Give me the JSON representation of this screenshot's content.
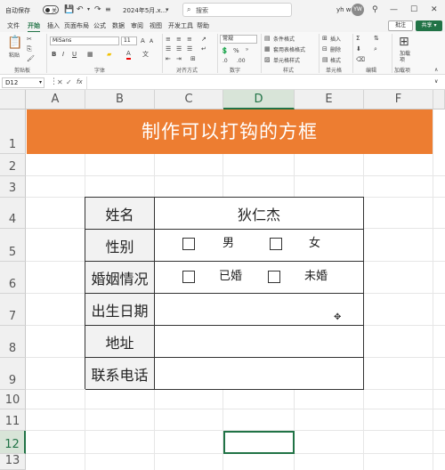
{
  "titlebar": {
    "autosave_label": "自动保存",
    "autosave_state": "关",
    "file_name": "2024年5月.x...",
    "search_placeholder": "搜索",
    "user_name": "yh w",
    "user_initials": "YW"
  },
  "menu": {
    "items": [
      "文件",
      "开始",
      "插入",
      "页面布局",
      "公式",
      "数据",
      "审阅",
      "视图",
      "开发工具",
      "帮助"
    ],
    "active": "开始",
    "comment_label": "批注",
    "share_label": "共享"
  },
  "ribbon": {
    "paste_label": "粘贴",
    "font_name": "MiSans",
    "font_size": "11",
    "number_format": "常规",
    "cond_format": "条件格式",
    "table_format": "套用表格格式",
    "cell_style": "单元格样式",
    "insert": "插入",
    "delete": "删除",
    "format": "格式",
    "addin_label": "加载项",
    "groups": [
      "剪贴板",
      "字体",
      "对齐方式",
      "数字",
      "样式",
      "单元格",
      "编辑",
      "加载项"
    ]
  },
  "formula_bar": {
    "name_box": "D12",
    "fx": "fx",
    "content": ""
  },
  "sheet": {
    "columns": [
      "A",
      "B",
      "C",
      "D",
      "E",
      "F"
    ],
    "selected_column": "D",
    "rows": [
      "1",
      "2",
      "3",
      "4",
      "5",
      "6",
      "7",
      "8",
      "9",
      "10",
      "11",
      "12",
      "13"
    ],
    "selected_row": "12",
    "selected_cell": "D12",
    "banner_title": "制作可以打钩的方框",
    "banner_color": "#ed7d31",
    "form": {
      "name_label": "姓名",
      "name_value": "狄仁杰",
      "gender_label": "性别",
      "gender_options": [
        "男",
        "女"
      ],
      "marital_label": "婚姻情况",
      "marital_options": [
        "已婚",
        "未婚"
      ],
      "birth_label": "出生日期",
      "address_label": "地址",
      "phone_label": "联系电话"
    }
  },
  "colors": {
    "accent": "#217346"
  }
}
